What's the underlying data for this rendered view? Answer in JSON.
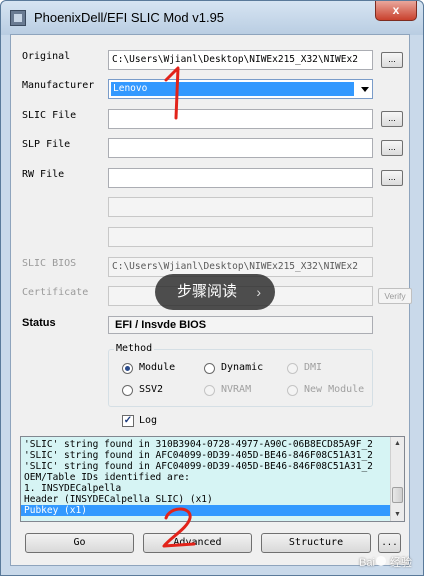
{
  "window": {
    "title": "PhoenixDell/EFI SLIC Mod v1.95",
    "close_label": "x"
  },
  "fields": [
    {
      "key": "original",
      "label": "Original",
      "value": "C:\\Users\\Wjianl\\Desktop\\NIWEx215_X32\\NIWEx2",
      "browse": "...",
      "enabled": true
    },
    {
      "key": "slic_file",
      "label": "SLIC File",
      "value": "",
      "browse": "...",
      "enabled": true
    },
    {
      "key": "slp_file",
      "label": "SLP File",
      "value": "",
      "browse": "...",
      "enabled": true
    },
    {
      "key": "rw_file",
      "label": "RW File",
      "value": "",
      "browse": "...",
      "enabled": true
    }
  ],
  "manufacturer": {
    "label": "Manufacturer",
    "value": "Lenovo"
  },
  "slic_bios": {
    "label": "SLIC BIOS",
    "value": "C:\\Users\\Wjianl\\Desktop\\NIWEx215_X32\\NIWEx2"
  },
  "certificate": {
    "label": "Certificate",
    "value": "",
    "verify": "Verify"
  },
  "status": {
    "label": "Status",
    "value": "EFI / Insvde BIOS"
  },
  "method": {
    "title": "Method",
    "options": [
      {
        "label": "Module",
        "selected": true,
        "enabled": true
      },
      {
        "label": "Dynamic",
        "selected": false,
        "enabled": true
      },
      {
        "label": "DMI",
        "selected": false,
        "enabled": false
      },
      {
        "label": "SSV2",
        "selected": false,
        "enabled": true
      },
      {
        "label": "NVRAM",
        "selected": false,
        "enabled": false
      },
      {
        "label": "New Module",
        "selected": false,
        "enabled": false
      }
    ]
  },
  "log_checkbox": {
    "label": "Log",
    "checked": true,
    "mark": "✓"
  },
  "log": {
    "lines": [
      "'SLIC' string found in 310B3904-0728-4977-A90C-06B8ECD85A9F_2",
      "'SLIC' string found in AFC04099-0D39-405D-BE46-846F08C51A31_2",
      "'SLIC' string found in AFC04099-0D39-405D-BE46-846F08C51A31_2",
      "OEM/Table IDs identified are:",
      "1. INSYDECalpella",
      "Header  (INSYDECalpella    SLIC) (x1)",
      "Pubkey  (x1)"
    ],
    "highlighted_index": 6
  },
  "buttons": {
    "go": "Go",
    "advanced": "Advanced",
    "structure": "Structure",
    "more": "..."
  },
  "overlay": {
    "text": "步骤阅读",
    "chevron": "›"
  },
  "annotations": [
    "1",
    "2"
  ],
  "watermark": "Baidu 经验",
  "colors": {
    "selection": "#3399ff",
    "log_bg": "#d6f4f4",
    "annotation": "#e2231a",
    "title_bar": "#c9d9ea"
  }
}
